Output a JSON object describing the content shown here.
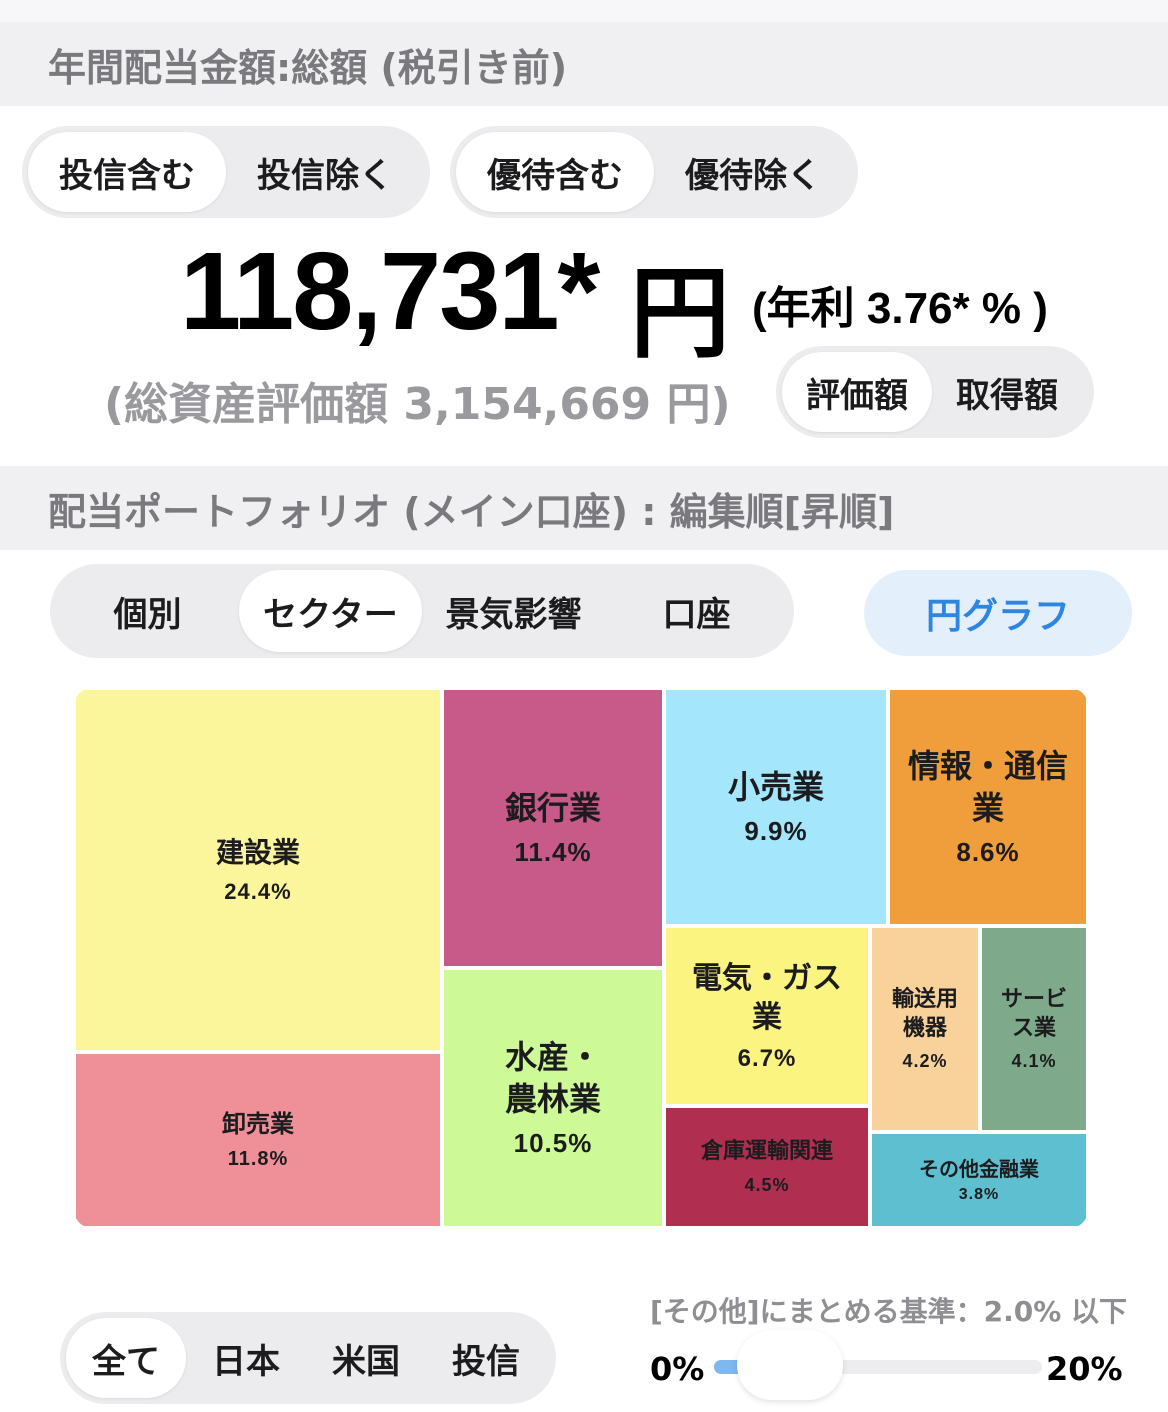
{
  "header_annual": "年間配当金額:総額 (税引き前)",
  "fund_toggle": {
    "include": "投信含む",
    "exclude": "投信除く",
    "selected": "include"
  },
  "yutai_toggle": {
    "include": "優待含む",
    "exclude": "優待除く",
    "selected": "include"
  },
  "annual_amount": "118,731*",
  "annual_unit": "円",
  "yield_text": "(年利 3.76* % )",
  "total_assets_text": "(総資産評価額 3,154,669 円)",
  "eval_toggle": {
    "eval": "評価額",
    "cost": "取得額",
    "selected": "eval"
  },
  "header_portfolio": "配当ポートフォリオ (メイン口座) : 編集順[昇順]",
  "view_tabs": [
    "個別",
    "セクター",
    "景気影響",
    "口座"
  ],
  "view_selected": 1,
  "pie_button": "円グラフ",
  "treemap": [
    {
      "name": "建設業",
      "pct": "24.4%",
      "color": "#fbf59c"
    },
    {
      "name": "卸売業",
      "pct": "11.8%",
      "color": "#ef9099"
    },
    {
      "name": "銀行業",
      "pct": "11.4%",
      "color": "#c85a8a"
    },
    {
      "name": "水産・\n農林業",
      "pct": "10.5%",
      "color": "#cdfa96"
    },
    {
      "name": "小売業",
      "pct": "9.9%",
      "color": "#a4e6fb"
    },
    {
      "name": "情報・通信\n業",
      "pct": "8.6%",
      "color": "#f09e3c"
    },
    {
      "name": "電気・ガス\n業",
      "pct": "6.7%",
      "color": "#fbf480"
    },
    {
      "name": "輸送用\n機器",
      "pct": "4.2%",
      "color": "#f8d29a"
    },
    {
      "name": "サービ\nス業",
      "pct": "4.1%",
      "color": "#7ea98a"
    },
    {
      "name": "倉庫運輸関連",
      "pct": "4.5%",
      "color": "#b02f50"
    },
    {
      "name": "その他金融業",
      "pct": "3.8%",
      "color": "#5ebfd0"
    }
  ],
  "region_tabs": [
    "全て",
    "日本",
    "米国",
    "投信"
  ],
  "region_selected": 0,
  "threshold_label": "[その他]にまとめる基準：2.0% 以下",
  "slider": {
    "min_label": "0%",
    "max_label": "20%",
    "value_percent": 2.0,
    "max_value": 20
  }
}
